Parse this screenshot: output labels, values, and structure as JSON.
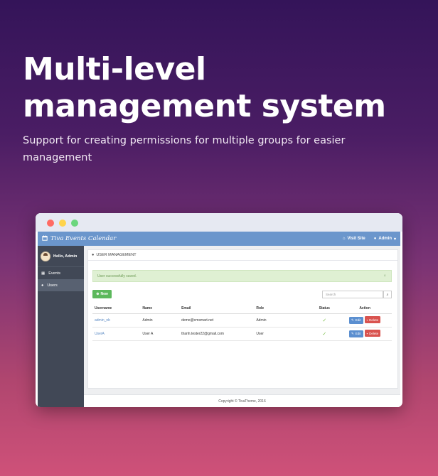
{
  "hero": {
    "title": "Multi-level management system",
    "subtitle": "Support for creating permissions for multiple groups for easier management"
  },
  "app": {
    "brand": "Tiva Events Calendar",
    "visit_site": "Visit Site",
    "admin_menu": "Admin",
    "greeting": "Hello, Admin",
    "nav": [
      {
        "label": "Events",
        "icon": "calendar-icon"
      },
      {
        "label": "Users",
        "icon": "user-icon",
        "active": true
      }
    ],
    "section_title": "USER MANAGEMENT",
    "alert": "User successfully saved.",
    "alert_close": "×",
    "new_button": "New",
    "search_placeholder": "Search",
    "table": {
      "columns": [
        "Username",
        "Name",
        "Email",
        "Role",
        "Status",
        "Action"
      ],
      "rows": [
        {
          "username": "admin_nb",
          "name": "Admin",
          "email": "demo@cmsmart.net",
          "role": "Admin",
          "status": "✓"
        },
        {
          "username": "UserA",
          "name": "User A",
          "email": "thanh.tester22@gmail.com",
          "role": "User",
          "status": "✓"
        }
      ],
      "edit_label": "Edit",
      "delete_label": "Delete"
    },
    "footer": "Copyright © TivaTheme, 2016"
  },
  "colors": {
    "appbar": "#6b96cc",
    "sidebar": "#414856",
    "success": "#5cb85c",
    "danger": "#d9534f",
    "edit": "#5b8fd0"
  }
}
